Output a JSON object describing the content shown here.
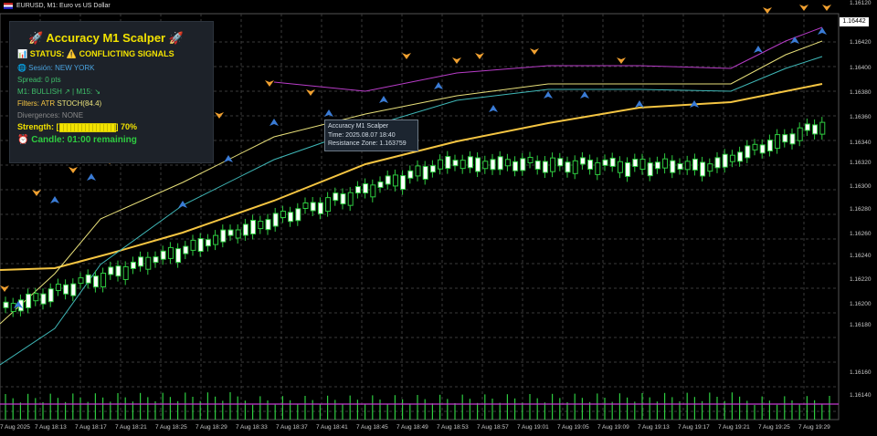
{
  "window": {
    "title": "EURUSD, M1:  Euro vs US Dollar"
  },
  "panel": {
    "title": "🚀 Accuracy M1 Scalper 🚀",
    "status": "📊 STATUS: ⚠️ CONFLICTING SIGNALS",
    "session": "🌐 Sesión: NEW YORK",
    "spread": "Spread: 0 pts",
    "trend": "M1: BULLISH ↗ | M15: ↘",
    "filters_label": "Filters: ATR",
    "filters_value": "STOCH(84.4)",
    "divergences": "Divergences: NONE",
    "strength_label": "Strength: [",
    "strength_value": "] 70%",
    "strength_fraction": 0.7,
    "candle": "⏰ Candle: 01:00 remaining"
  },
  "tooltip": {
    "line1": "Accuracy M1 Scalper",
    "line2": "Time: 2025.08.07 18:40",
    "line3": "Resistance Zone: 1.163759"
  },
  "current_price": "1.16442",
  "y_axis": [
    "1.16442",
    "1.16420",
    "1.16400",
    "1.16380",
    "1.16360",
    "1.16340",
    "1.16320",
    "1.16300",
    "1.16280",
    "1.16260",
    "1.16240",
    "1.16220",
    "1.16200",
    "1.16180",
    "1.16160",
    "1.16140",
    "1.16120"
  ],
  "x_axis": [
    "7 Aug 2025",
    "7 Aug 18:13",
    "7 Aug 18:17",
    "7 Aug 18:21",
    "7 Aug 18:25",
    "7 Aug 18:29",
    "7 Aug 18:33",
    "7 Aug 18:37",
    "7 Aug 18:41",
    "7 Aug 18:45",
    "7 Aug 18:49",
    "7 Aug 18:53",
    "7 Aug 18:57",
    "7 Aug 19:01",
    "7 Aug 19:05",
    "7 Aug 19:09",
    "7 Aug 19:13",
    "7 Aug 19:17",
    "7 Aug 19:21",
    "7 Aug 19:25",
    "7 Aug 19:29"
  ],
  "colors": {
    "bull": "#ffffff",
    "bull_border": "#2ecc40",
    "bear": "#000000",
    "bear_border": "#2ecc40",
    "ma_slow": "#f5c542",
    "ma_mid": "#e8e07a",
    "ma_fast": "#3fb8b8",
    "ma_purple": "#b83cc8",
    "buy_arrow": "#3a7bd5",
    "sell_arrow": "#f0a030",
    "volume": "#2ecc40"
  }
}
